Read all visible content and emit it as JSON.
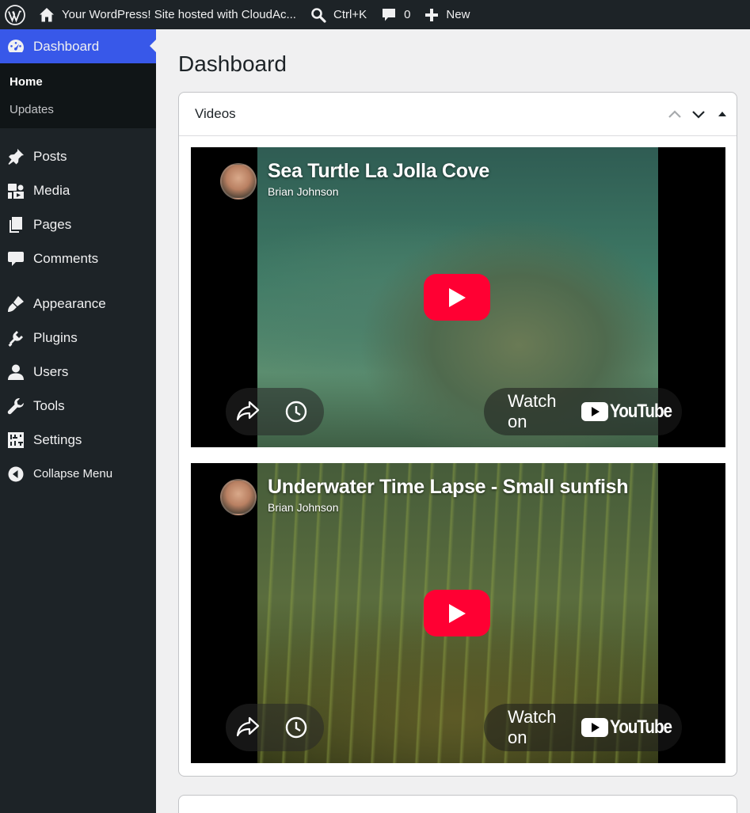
{
  "admin_bar": {
    "site_name": "Your WordPress! Site hosted with CloudAc...",
    "search_shortcut": "Ctrl+K",
    "comments_count": "0",
    "new_label": "New"
  },
  "sidebar": {
    "dashboard_label": "Dashboard",
    "submenu": [
      {
        "label": "Home"
      },
      {
        "label": "Updates"
      }
    ],
    "items": [
      {
        "label": "Posts",
        "icon": "pin-icon"
      },
      {
        "label": "Media",
        "icon": "media-icon"
      },
      {
        "label": "Pages",
        "icon": "pages-icon"
      },
      {
        "label": "Comments",
        "icon": "comment-icon"
      },
      {
        "label": "Appearance",
        "icon": "brush-icon"
      },
      {
        "label": "Plugins",
        "icon": "plug-icon"
      },
      {
        "label": "Users",
        "icon": "user-icon"
      },
      {
        "label": "Tools",
        "icon": "wrench-icon"
      },
      {
        "label": "Settings",
        "icon": "sliders-icon"
      }
    ],
    "collapse_label": "Collapse Menu"
  },
  "main": {
    "page_title": "Dashboard",
    "widget_title": "Videos",
    "videos": [
      {
        "title": "Sea Turtle La Jolla Cove",
        "channel": "Brian Johnson",
        "watch_label": "Watch on",
        "brand": "YouTube"
      },
      {
        "title": "Underwater Time Lapse - Small sunfish",
        "channel": "Brian Johnson",
        "watch_label": "Watch on",
        "brand": "YouTube"
      }
    ]
  },
  "colors": {
    "adminbar_bg": "#1d2327",
    "active_menu": "#3858e9",
    "youtube_red": "#ff0033"
  }
}
